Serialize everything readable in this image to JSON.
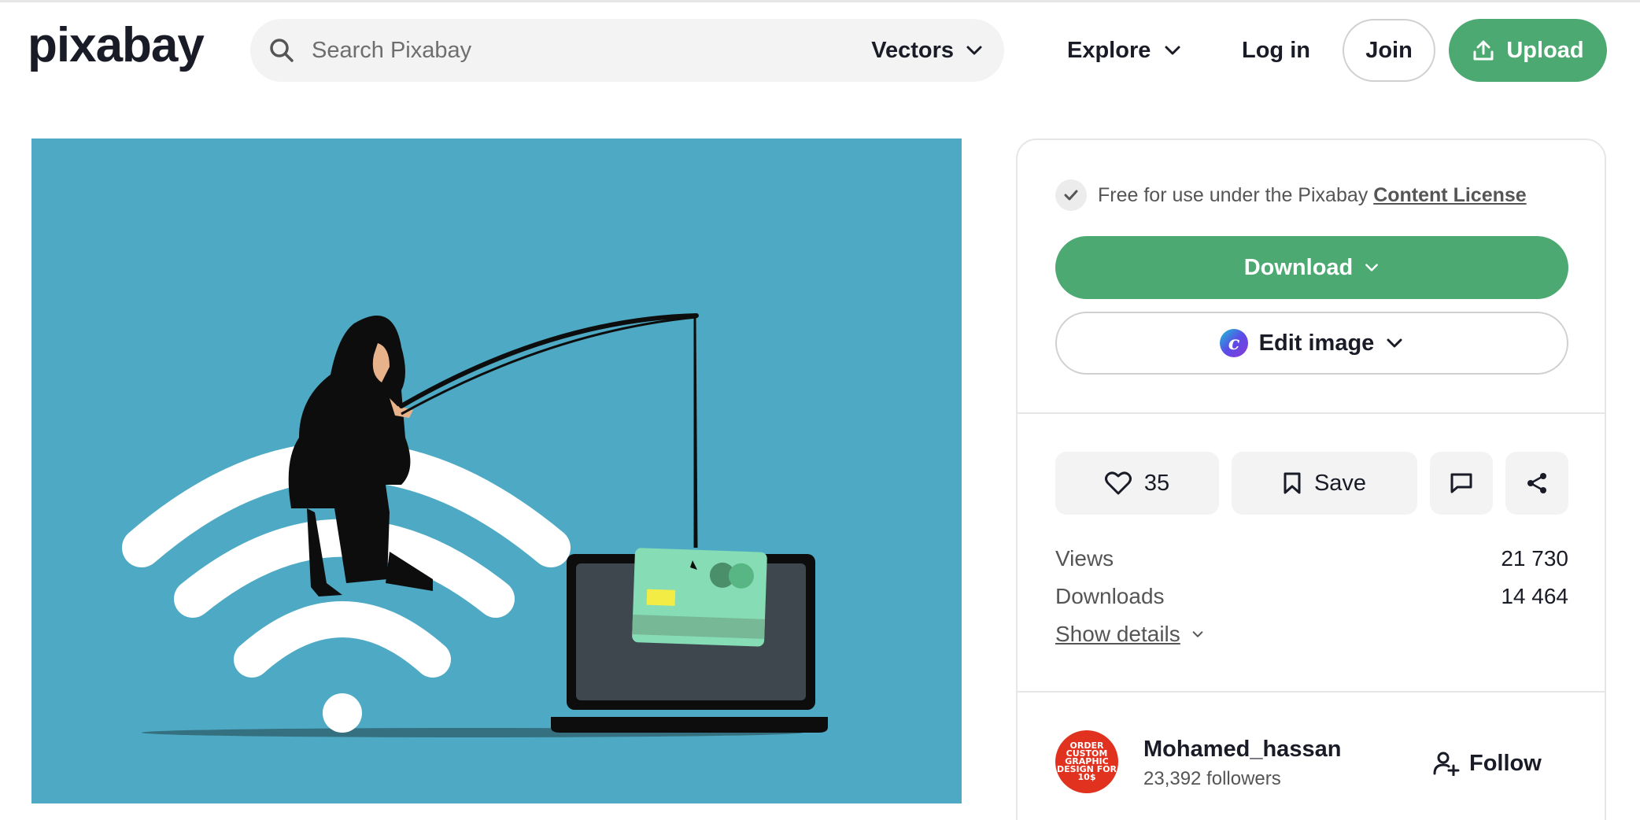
{
  "header": {
    "logo_text": "pixabay",
    "search": {
      "placeholder": "Search Pixabay",
      "type_selected": "Vectors"
    },
    "explore_label": "Explore",
    "login_label": "Log in",
    "join_label": "Join",
    "upload_label": "Upload"
  },
  "image": {
    "subject_icon": "phishing-hacker-fishing-credit-card-illustration",
    "background_color": "#4eaac4"
  },
  "sidebar": {
    "license": {
      "text": "Free for use under the Pixabay ",
      "link_label": "Content License"
    },
    "download_label": "Download",
    "edit_label": "Edit image",
    "actions": {
      "like_count": "35",
      "save_label": "Save"
    },
    "stats": [
      {
        "label": "Views",
        "value": "21 730"
      },
      {
        "label": "Downloads",
        "value": "14 464"
      }
    ],
    "show_details_label": "Show details",
    "author": {
      "name": "Mohamed_hassan",
      "followers": "23,392 followers",
      "avatar_text": "ORDER CUSTOM GRAPHIC DESIGN FOR 10$",
      "follow_label": "Follow"
    }
  },
  "colors": {
    "accent": "#4ca971",
    "text": "#191b26",
    "muted": "#555555",
    "surface": "#f3f3f3"
  }
}
